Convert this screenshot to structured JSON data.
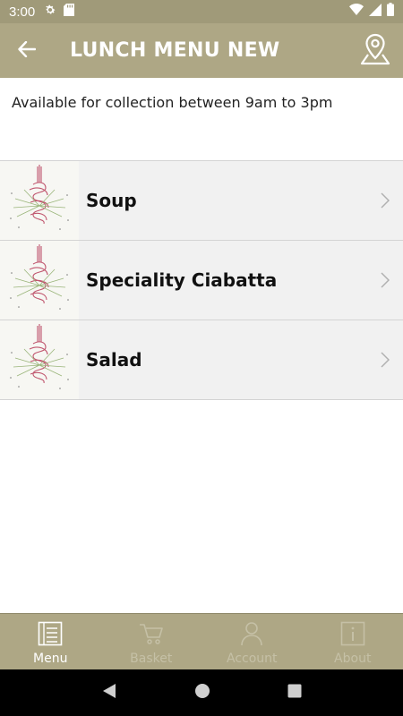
{
  "status_bar": {
    "time": "3:00",
    "left_icons": [
      "gear-icon",
      "sd-card-icon"
    ],
    "right_icons": [
      "wifi-icon",
      "signal-icon",
      "battery-icon"
    ]
  },
  "app_bar": {
    "title": "LUNCH MENU NEW",
    "back_icon": "arrow-left-icon",
    "location_icon": "map-pin-icon"
  },
  "info": {
    "text": "Available for collection between 9am to 3pm"
  },
  "menu_items": [
    {
      "label": "Soup",
      "thumb_icon": "brand-illustration-icon",
      "chevron_icon": "chevron-right-icon"
    },
    {
      "label": "Speciality Ciabatta",
      "thumb_icon": "brand-illustration-icon",
      "chevron_icon": "chevron-right-icon"
    },
    {
      "label": "Salad",
      "thumb_icon": "brand-illustration-icon",
      "chevron_icon": "chevron-right-icon"
    }
  ],
  "bottom_nav": {
    "items": [
      {
        "label": "Menu",
        "icon": "menu-list-icon",
        "active": true
      },
      {
        "label": "Basket",
        "icon": "cart-icon",
        "active": false
      },
      {
        "label": "Account",
        "icon": "person-icon",
        "active": false
      },
      {
        "label": "About",
        "icon": "info-icon",
        "active": false
      }
    ]
  },
  "colors": {
    "app_bar": "#aea785",
    "status_bar": "#a09a79",
    "list_bg": "#f1f1f1",
    "thumb_accent": "#c0566e"
  }
}
